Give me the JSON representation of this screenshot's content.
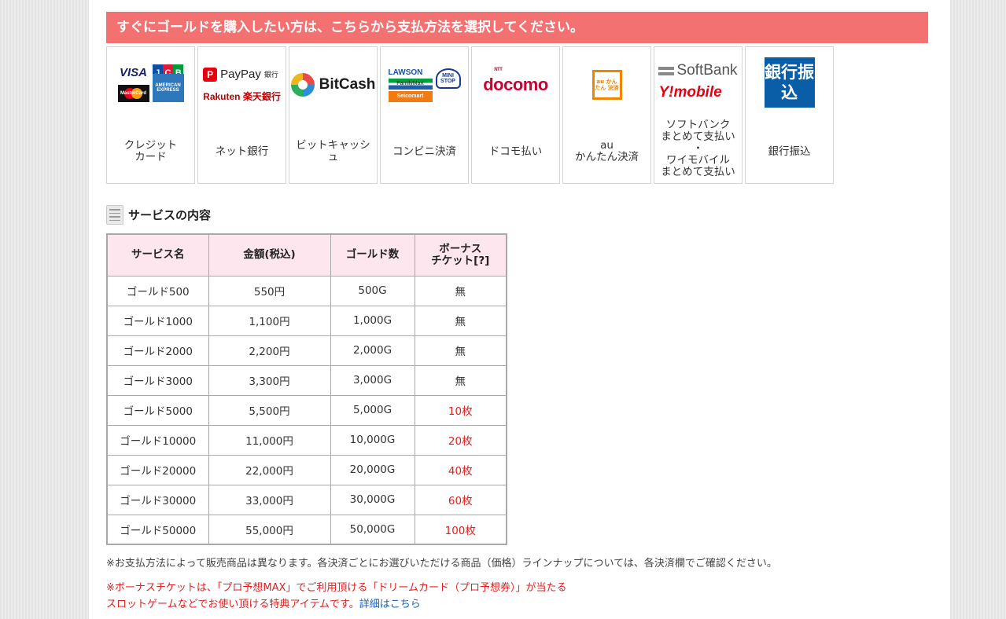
{
  "banner": "すぐにゴールドを購入したい方は、こちらから支払方法を選択してください。",
  "payment_methods": [
    {
      "id": "credit",
      "label": "クレジット\nカード",
      "logo": {
        "visa": "VISA",
        "jcb": [
          "J",
          "C",
          "B"
        ],
        "mastercard": "MasterCard",
        "amex": "AMERICAN EXPRESS"
      }
    },
    {
      "id": "netbank",
      "label": "ネット銀行",
      "logo": {
        "paypay": "PayPay",
        "paypay_sub": "銀行",
        "rakuten": "Rakuten 楽天銀行"
      }
    },
    {
      "id": "bitcash",
      "label": "ビットキャッシュ",
      "logo": {
        "text": "BitCash"
      }
    },
    {
      "id": "konbini",
      "label": "コンビニ決済",
      "logo": {
        "lawson": "LAWSON",
        "ministop": "MINI STOP",
        "familymart": "FamilyMart",
        "seicomart": "Seicomart"
      }
    },
    {
      "id": "docomo",
      "label": "ドコモ払い",
      "logo": {
        "text": "docomo",
        "small": "NTT"
      }
    },
    {
      "id": "au",
      "label": "au\nかんたん決済",
      "logo": {
        "text": "au かんたん 決済"
      }
    },
    {
      "id": "softbank",
      "label": "ソフトバンク\nまとめて支払い\n・\nワイモバイル\nまとめて支払い",
      "logo": {
        "softbank": "SoftBank",
        "ymobile": "Y!mobile"
      }
    },
    {
      "id": "bank",
      "label": "銀行振込",
      "logo": {
        "text": "銀行振込"
      }
    }
  ],
  "section": {
    "title": "サービスの内容",
    "icon": "document-icon"
  },
  "table": {
    "headers": [
      "サービス名",
      "金額(税込)",
      "ゴールド数",
      "ボーナス\nチケット[?]"
    ],
    "rows": [
      [
        "ゴールド500",
        "550円",
        "500G",
        "無"
      ],
      [
        "ゴールド1000",
        "1,100円",
        "1,000G",
        "無"
      ],
      [
        "ゴールド2000",
        "2,200円",
        "2,000G",
        "無"
      ],
      [
        "ゴールド3000",
        "3,300円",
        "3,000G",
        "無"
      ],
      [
        "ゴールド5000",
        "5,500円",
        "5,000G",
        "10枚"
      ],
      [
        "ゴールド10000",
        "11,000円",
        "10,000G",
        "20枚"
      ],
      [
        "ゴールド20000",
        "22,000円",
        "20,000G",
        "40枚"
      ],
      [
        "ゴールド30000",
        "33,000円",
        "30,000G",
        "60枚"
      ],
      [
        "ゴールド50000",
        "55,000円",
        "50,000G",
        "100枚"
      ]
    ]
  },
  "notes": {
    "line1": "※お支払方法によって販売商品は異なります。各決済ごとにお選びいただける商品（価格）ラインナップについては、各決済欄でご確認ください。",
    "line2": "※ボーナスチケットは、「プロ予想MAX」でご利用頂ける「ドリームカード（プロ予想券）」が当たる",
    "line3": "スロットゲームなどでお使い頂ける特典アイテムです。",
    "link": "詳細はこちら"
  },
  "colors": {
    "banner": "#f37171",
    "table_header": "#fde6ee",
    "bonus_red": "#e02020",
    "link": "#1a5fb0"
  }
}
